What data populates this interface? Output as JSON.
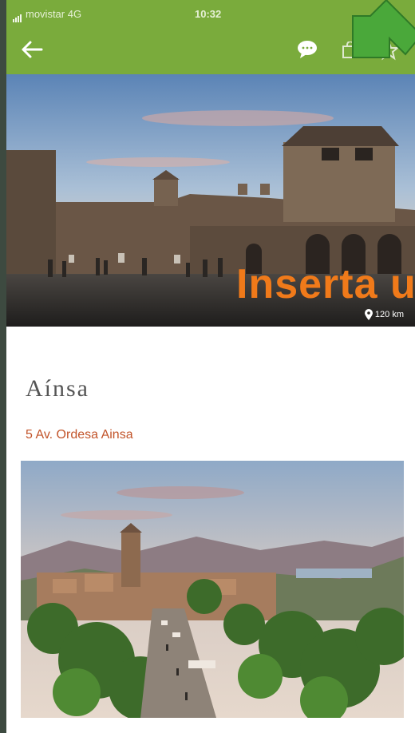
{
  "status": {
    "carrier": "movistar  4G",
    "time": "10:32"
  },
  "appbar": {
    "back_icon": "arrow-left-icon",
    "chat_icon": "chat-bubble-icon",
    "bag_icon": "bag-icon",
    "favorite_icon": "star-icon",
    "color": "#7aab3c"
  },
  "hero": {
    "overlay_text": "Inserta u",
    "distance": "120 km",
    "accent": "#f07a1a"
  },
  "place": {
    "name": "Aínsa",
    "address": "5 Av. Ordesa Ainsa",
    "address_color": "#c2542a"
  }
}
